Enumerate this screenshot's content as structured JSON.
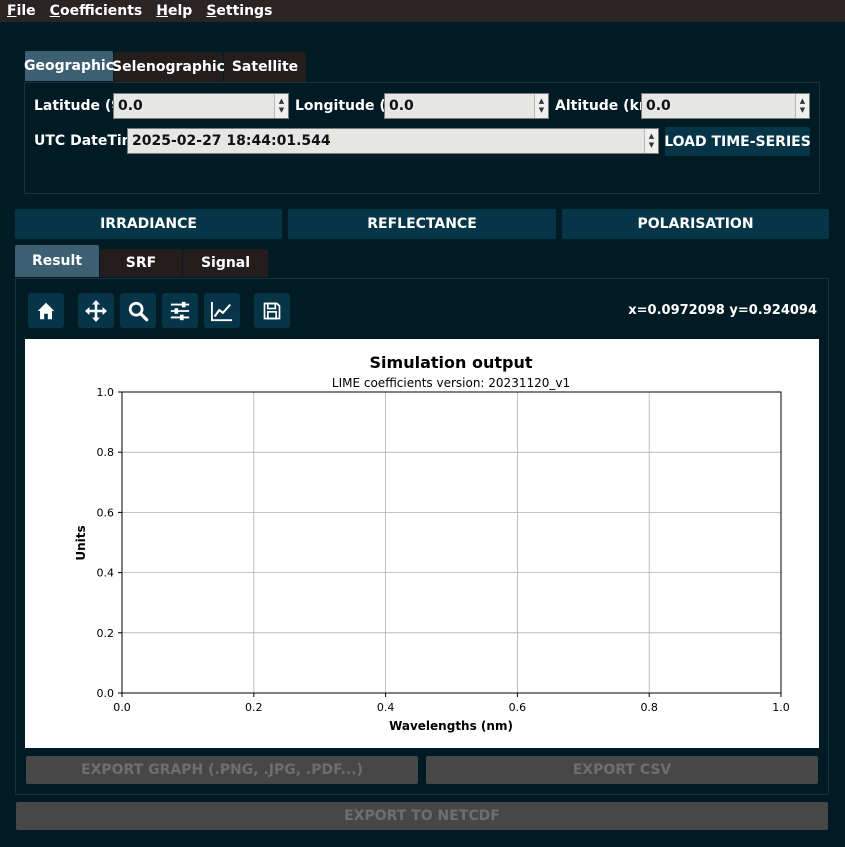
{
  "menu": {
    "items": [
      {
        "label": "File",
        "ul": "F",
        "rest": "ile"
      },
      {
        "label": "Coefficients",
        "ul": "C",
        "rest": "oefficients"
      },
      {
        "label": "Help",
        "ul": "H",
        "rest": "elp"
      },
      {
        "label": "Settings",
        "ul": "S",
        "rest": "ettings"
      }
    ]
  },
  "location_tabs": [
    "Geographic",
    "Selenographic",
    "Satellite"
  ],
  "geo": {
    "lat_label": "Latitude (º):",
    "lat_value": "0.0",
    "lon_label": "Longitude (º):",
    "lon_value": "0.0",
    "alt_label": "Altitude (km):",
    "alt_value": "0.0",
    "utc_label": "UTC DateTime:",
    "utc_value": "2025-02-27 18:44:01.544",
    "load_button": "LOAD TIME-SERIES"
  },
  "actions": {
    "irradiance": "IRRADIANCE",
    "reflectance": "REFLECTANCE",
    "polarisation": "POLARISATION"
  },
  "result_tabs": [
    "Result",
    "SRF",
    "Signal"
  ],
  "toolbar": {
    "icons": [
      "home-icon",
      "pan-icon",
      "zoom-icon",
      "configure-subplots-icon",
      "edit-axis-icon",
      "save-icon"
    ],
    "coords": "x=0.0972098  y=0.924094"
  },
  "export": {
    "graph": "EXPORT GRAPH (.PNG, .JPG, .PDF...)",
    "csv": "EXPORT CSV",
    "netcdf": "EXPORT TO NETCDF"
  },
  "colors": {
    "accent": "#053547",
    "active_tab": "#3c5f72",
    "background": "#001b24",
    "disabled": "#474747"
  },
  "chart_data": {
    "type": "line",
    "title": "Simulation output",
    "subtitle": "LIME coefficients version: 20231120_v1",
    "xlabel": "Wavelengths (nm)",
    "ylabel": "Units",
    "xlim": [
      0.0,
      1.0
    ],
    "ylim": [
      0.0,
      1.0
    ],
    "xticks": [
      "0.0",
      "0.2",
      "0.4",
      "0.6",
      "0.8",
      "1.0"
    ],
    "yticks": [
      "0.0",
      "0.2",
      "0.4",
      "0.6",
      "0.8",
      "1.0"
    ],
    "grid": true,
    "series": []
  }
}
